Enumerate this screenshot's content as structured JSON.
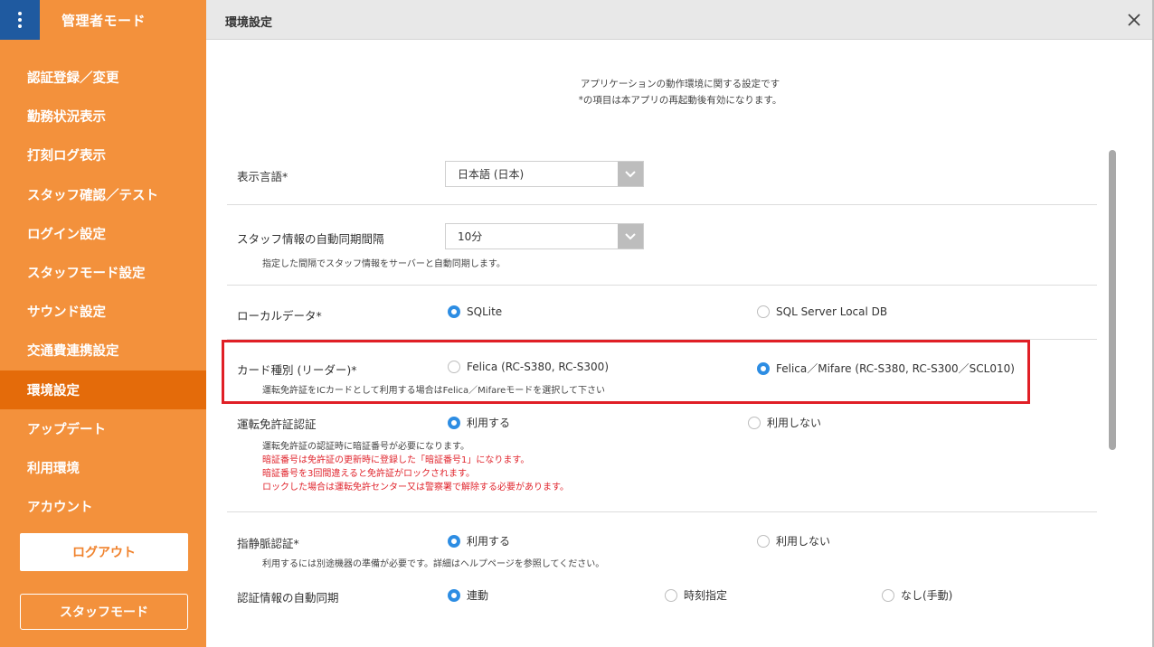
{
  "sidebar": {
    "title": "管理者モード",
    "items": [
      {
        "label": "認証登録／変更"
      },
      {
        "label": "勤務状況表示"
      },
      {
        "label": "打刻ログ表示"
      },
      {
        "label": "スタッフ確認／テスト"
      },
      {
        "label": "ログイン設定"
      },
      {
        "label": "スタッフモード設定"
      },
      {
        "label": "サウンド設定"
      },
      {
        "label": "交通費連携設定"
      },
      {
        "label": "環境設定",
        "active": true
      },
      {
        "label": "アップデート"
      },
      {
        "label": "利用環境"
      },
      {
        "label": "アカウント"
      }
    ],
    "logout_label": "ログアウト",
    "staff_mode_label": "スタッフモード"
  },
  "header": {
    "title": "環境設定",
    "close_icon": "close-icon"
  },
  "intro": {
    "line1": "アプリケーションの動作環境に関する設定です",
    "line2": "*の項目は本アプリの再起動後有効になります。"
  },
  "settings": {
    "language": {
      "label": "表示言語*",
      "value": "日本語 (日本)"
    },
    "sync_interval": {
      "label": "スタッフ情報の自動同期間隔",
      "value": "10分",
      "note": "指定した間隔でスタッフ情報をサーバーと自動同期します。"
    },
    "local_data": {
      "label": "ローカルデータ*",
      "option1": "SQLite",
      "option2": "SQL Server Local DB",
      "selected": "SQLite"
    },
    "card_type": {
      "label": "カード種別 (リーダー)*",
      "option1": "Felica (RC-S380, RC-S300)",
      "option2": "Felica／Mifare (RC-S380, RC-S300／SCL010)",
      "selected": "Felica／Mifare (RC-S380, RC-S300／SCL010)",
      "note": "運転免許証をICカードとして利用する場合はFelica／Mifareモードを選択して下さい"
    },
    "license_auth": {
      "label": "運転免許証認証",
      "option1": "利用する",
      "option2": "利用しない",
      "selected": "利用する",
      "note": "運転免許証の認証時に暗証番号が必要になります。",
      "warn1": "暗証番号は免許証の更新時に登録した「暗証番号1」になります。",
      "warn2": "暗証番号を3回間違えると免許証がロックされます。",
      "warn3": "ロックした場合は運転免許センター又は警察署で解除する必要があります。"
    },
    "vein_auth": {
      "label": "指静脈認証*",
      "option1": "利用する",
      "option2": "利用しない",
      "selected": "利用する",
      "note": "利用するには別途機器の準備が必要です。詳細はヘルプページを参照してください。"
    },
    "auto_sync": {
      "label": "認証情報の自動同期",
      "option1": "連動",
      "option2": "時刻指定",
      "option3": "なし(手動)",
      "selected": "連動"
    }
  },
  "colors": {
    "sidebar": "#f3913c",
    "sidebar_active": "#e46b0a",
    "menu_button": "#1f5aa0",
    "radio_selected": "#2d8de3",
    "warning_text": "#e0242c",
    "highlight_border": "#e01f26"
  }
}
